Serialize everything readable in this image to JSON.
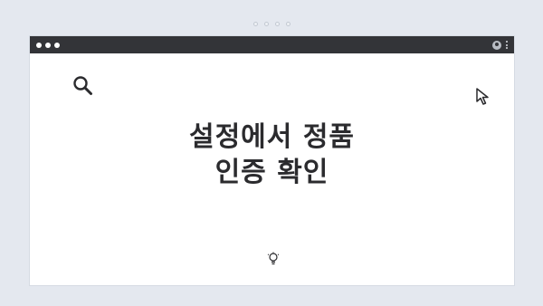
{
  "window": {
    "titlebar_color": "#333438",
    "background_color": "#ffffff"
  },
  "page_background": "#e4e8ef",
  "icons": {
    "search": "search-icon",
    "cursor": "cursor-arrow-icon",
    "idea": "lightbulb-icon",
    "user": "user-icon",
    "menu": "more-vertical-icon"
  },
  "headline": {
    "line1": "설정에서 정품",
    "line2": "인증 확인"
  }
}
